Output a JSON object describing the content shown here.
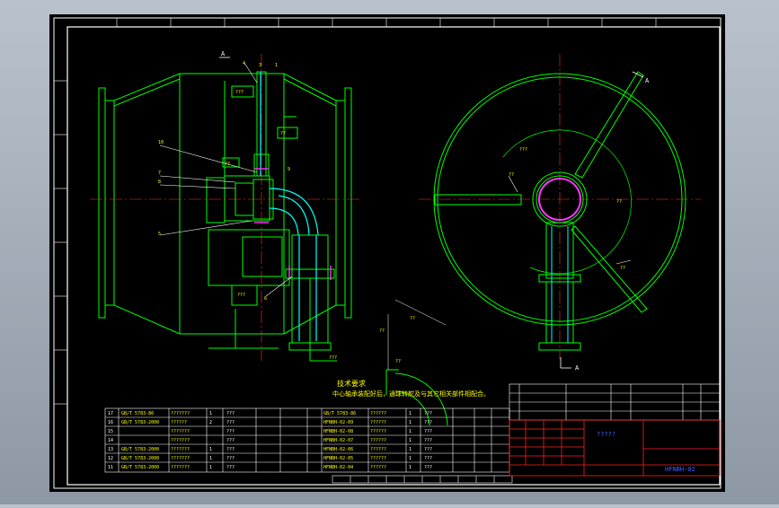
{
  "view_labels": {
    "a_top_left": "A",
    "a_right_top": "A",
    "a_right_bottom": "A"
  },
  "tech_notes": {
    "line1": "技术要求",
    "line2": "中心轴承装配好后，通球转舵及与其它相关部件相配合。"
  },
  "title_block": {
    "name_field": "?????",
    "drawing_number": "HFNBH-02"
  },
  "bom_rows": [
    {
      "n1": "17",
      "c1": "GB/T 5783-86",
      "c2": "???????",
      "n2": "1",
      "m1": "???",
      "q1": "",
      "n3": "",
      "c3": "GB/T 5783-86",
      "c4": "??????",
      "n4": "1",
      "m2": "???",
      "v1": "",
      "v2": ""
    },
    {
      "n1": "16",
      "c1": "GB/T 5783-2000",
      "c2": "??????",
      "n2": "2",
      "m1": "???",
      "q1": "",
      "n3": "",
      "c3": "HFNBH-02-09",
      "c4": "??????",
      "n4": "1",
      "m2": "???",
      "v1": "",
      "v2": ""
    },
    {
      "n1": "15",
      "c1": "",
      "c2": "???????",
      "n2": "",
      "m1": "???",
      "q1": "",
      "n3": "",
      "c3": "HFNBH-02-08",
      "c4": "??????",
      "n4": "1",
      "m2": "???",
      "v1": "",
      "v2": ""
    },
    {
      "n1": "14",
      "c1": "",
      "c2": "???????",
      "n2": "",
      "m1": "???",
      "q1": "",
      "n3": "",
      "c3": "HFNBH-02-07",
      "c4": "??????",
      "n4": "1",
      "m2": "???",
      "v1": "",
      "v2": ""
    },
    {
      "n1": "13",
      "c1": "GB/T 5783-2000",
      "c2": "???????",
      "n2": "1",
      "m1": "???",
      "q1": "",
      "n3": "",
      "c3": "HFNBH-02-06",
      "c4": "??????",
      "n4": "1",
      "m2": "???",
      "v1": "",
      "v2": ""
    },
    {
      "n1": "12",
      "c1": "GB/T 5783-2000",
      "c2": "???????",
      "n2": "1",
      "m1": "???",
      "q1": "",
      "n3": "",
      "c3": "HFNBH-02-05",
      "c4": "??????",
      "n4": "1",
      "m2": "???",
      "v1": "",
      "v2": ""
    },
    {
      "n1": "11",
      "c1": "GB/T 5783-2000",
      "c2": "???????",
      "n2": "1",
      "m1": "???",
      "q1": "",
      "n3": "",
      "c3": "HFNBH-02-04",
      "c4": "??????",
      "n4": "1",
      "m2": "???",
      "v1": "",
      "v2": ""
    }
  ]
}
